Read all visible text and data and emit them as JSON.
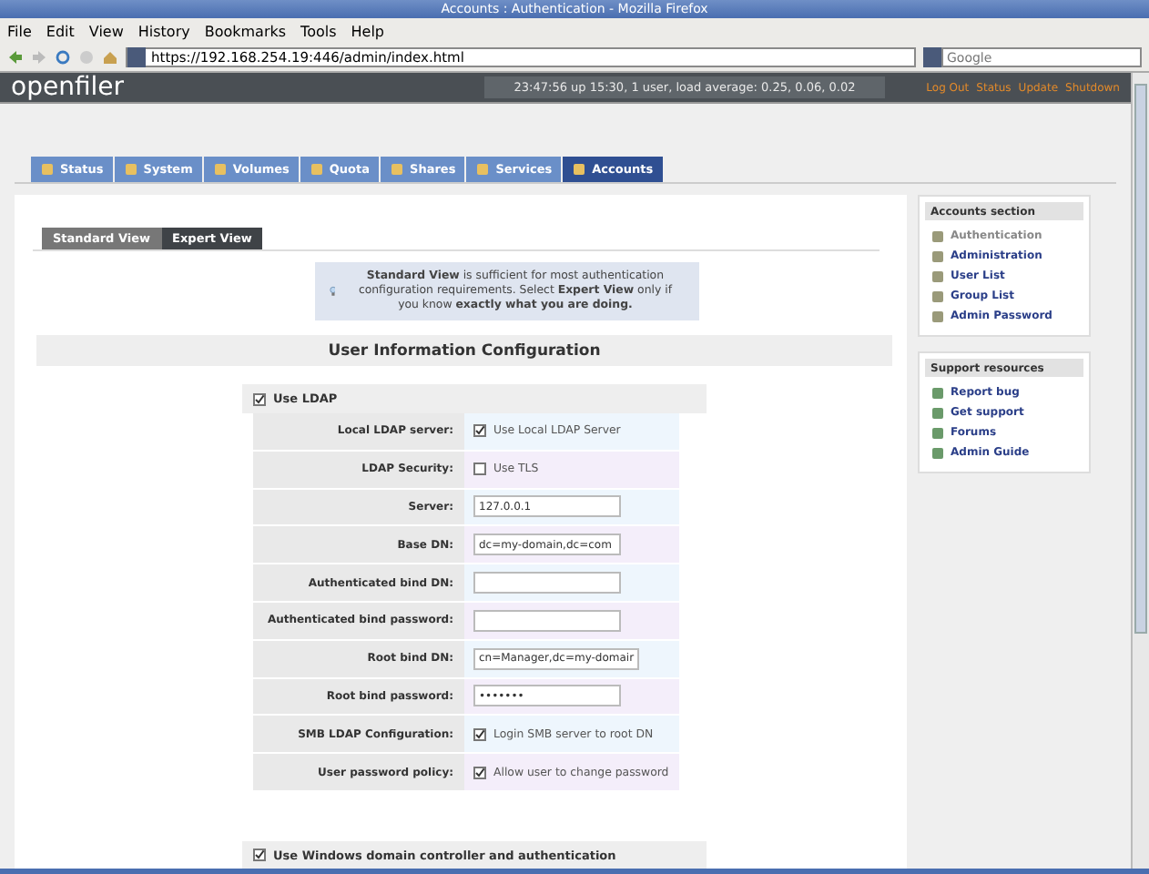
{
  "window": {
    "title": "Accounts : Authentication - Mozilla Firefox"
  },
  "menu": [
    "File",
    "Edit",
    "View",
    "History",
    "Bookmarks",
    "Tools",
    "Help"
  ],
  "address_bar": {
    "url": "https://192.168.254.19:446/admin/index.html"
  },
  "search": {
    "placeholder": "Google"
  },
  "header": {
    "logo": "openfiler",
    "uptime": "23:47:56 up 15:30, 1 user, load average: 0.25, 0.06, 0.02",
    "links": [
      "Log Out",
      "Status",
      "Update",
      "Shutdown"
    ]
  },
  "tabs": [
    {
      "label": "Status",
      "selected": false
    },
    {
      "label": "System",
      "selected": false
    },
    {
      "label": "Volumes",
      "selected": false
    },
    {
      "label": "Quota",
      "selected": false
    },
    {
      "label": "Shares",
      "selected": false
    },
    {
      "label": "Services",
      "selected": false
    },
    {
      "label": "Accounts",
      "selected": true
    }
  ],
  "view_tabs": [
    {
      "label": "Standard View",
      "selected": false
    },
    {
      "label": "Expert View",
      "selected": true
    }
  ],
  "info_box": {
    "text": "**Standard View** is sufficient for most authentication configuration requirements. Select **Expert View** only if you know **exactly what you are doing.**"
  },
  "section_title": "User Information Configuration",
  "use_ldap": {
    "label": "Use LDAP",
    "checked": true
  },
  "form_rows": [
    {
      "label": "Local LDAP server:",
      "kind": "checkbox",
      "checked": true,
      "text": "Use Local LDAP Server"
    },
    {
      "label": "LDAP Security:",
      "kind": "checkbox",
      "checked": false,
      "text": "Use TLS"
    },
    {
      "label": "Server:",
      "kind": "input",
      "value": "127.0.0.1"
    },
    {
      "label": "Base DN:",
      "kind": "input",
      "value": "dc=my-domain,dc=com"
    },
    {
      "label": "Authenticated bind DN:",
      "kind": "input"
    },
    {
      "label": "Authenticated bind password:",
      "kind": "input"
    },
    {
      "label": "Root bind DN:",
      "kind": "input",
      "value": "cn=Manager,dc=my-domair"
    },
    {
      "label": "Root bind password:",
      "kind": "input",
      "value": "•••••••"
    },
    {
      "label": "SMB LDAP Configuration:",
      "kind": "checkbox",
      "checked": true,
      "text": "Login SMB server to root DN"
    },
    {
      "label": "User password policy:",
      "kind": "checkbox",
      "checked": true,
      "text": "Allow user to change password"
    }
  ],
  "use_windows": {
    "label": "Use Windows domain controller and authentication",
    "checked": true
  },
  "sidebar": [
    {
      "title": "Accounts section",
      "items": [
        {
          "label": "Authentication",
          "selected": true
        },
        {
          "label": "Administration",
          "selected": false
        },
        {
          "label": "User List",
          "selected": false
        },
        {
          "label": "Group List",
          "selected": false
        },
        {
          "label": "Admin Password",
          "selected": false
        }
      ]
    },
    {
      "title": "Support resources",
      "items": [
        {
          "label": "Report bug",
          "selected": false
        },
        {
          "label": "Get support",
          "selected": false
        },
        {
          "label": "Forums",
          "selected": false
        },
        {
          "label": "Admin Guide",
          "selected": false
        }
      ]
    }
  ]
}
